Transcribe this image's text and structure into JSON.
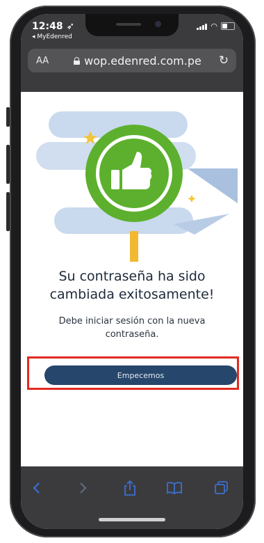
{
  "status_bar": {
    "time": "12:48 ➶",
    "back_app": "◂ MyEdenred"
  },
  "browser": {
    "text_size_label": "AA",
    "url": "wop.edenred.com.pe"
  },
  "page": {
    "title_line1": "Su contraseña ha sido",
    "title_line2": "cambiada exitosamente!",
    "subtitle_line1": "Debe iniciar sesión con la nueva",
    "subtitle_line2": "contraseña.",
    "cta_label": "Empecemos"
  },
  "icons": [
    "lock-icon",
    "reload-icon",
    "thumbs-up-icon",
    "back-icon",
    "forward-icon",
    "share-icon",
    "bookmarks-icon",
    "tabs-icon"
  ],
  "colors": {
    "button": "#27466b",
    "highlight": "#e02b20",
    "thumb_circle": "#5db02e",
    "stripes": "#c9d9ee"
  }
}
